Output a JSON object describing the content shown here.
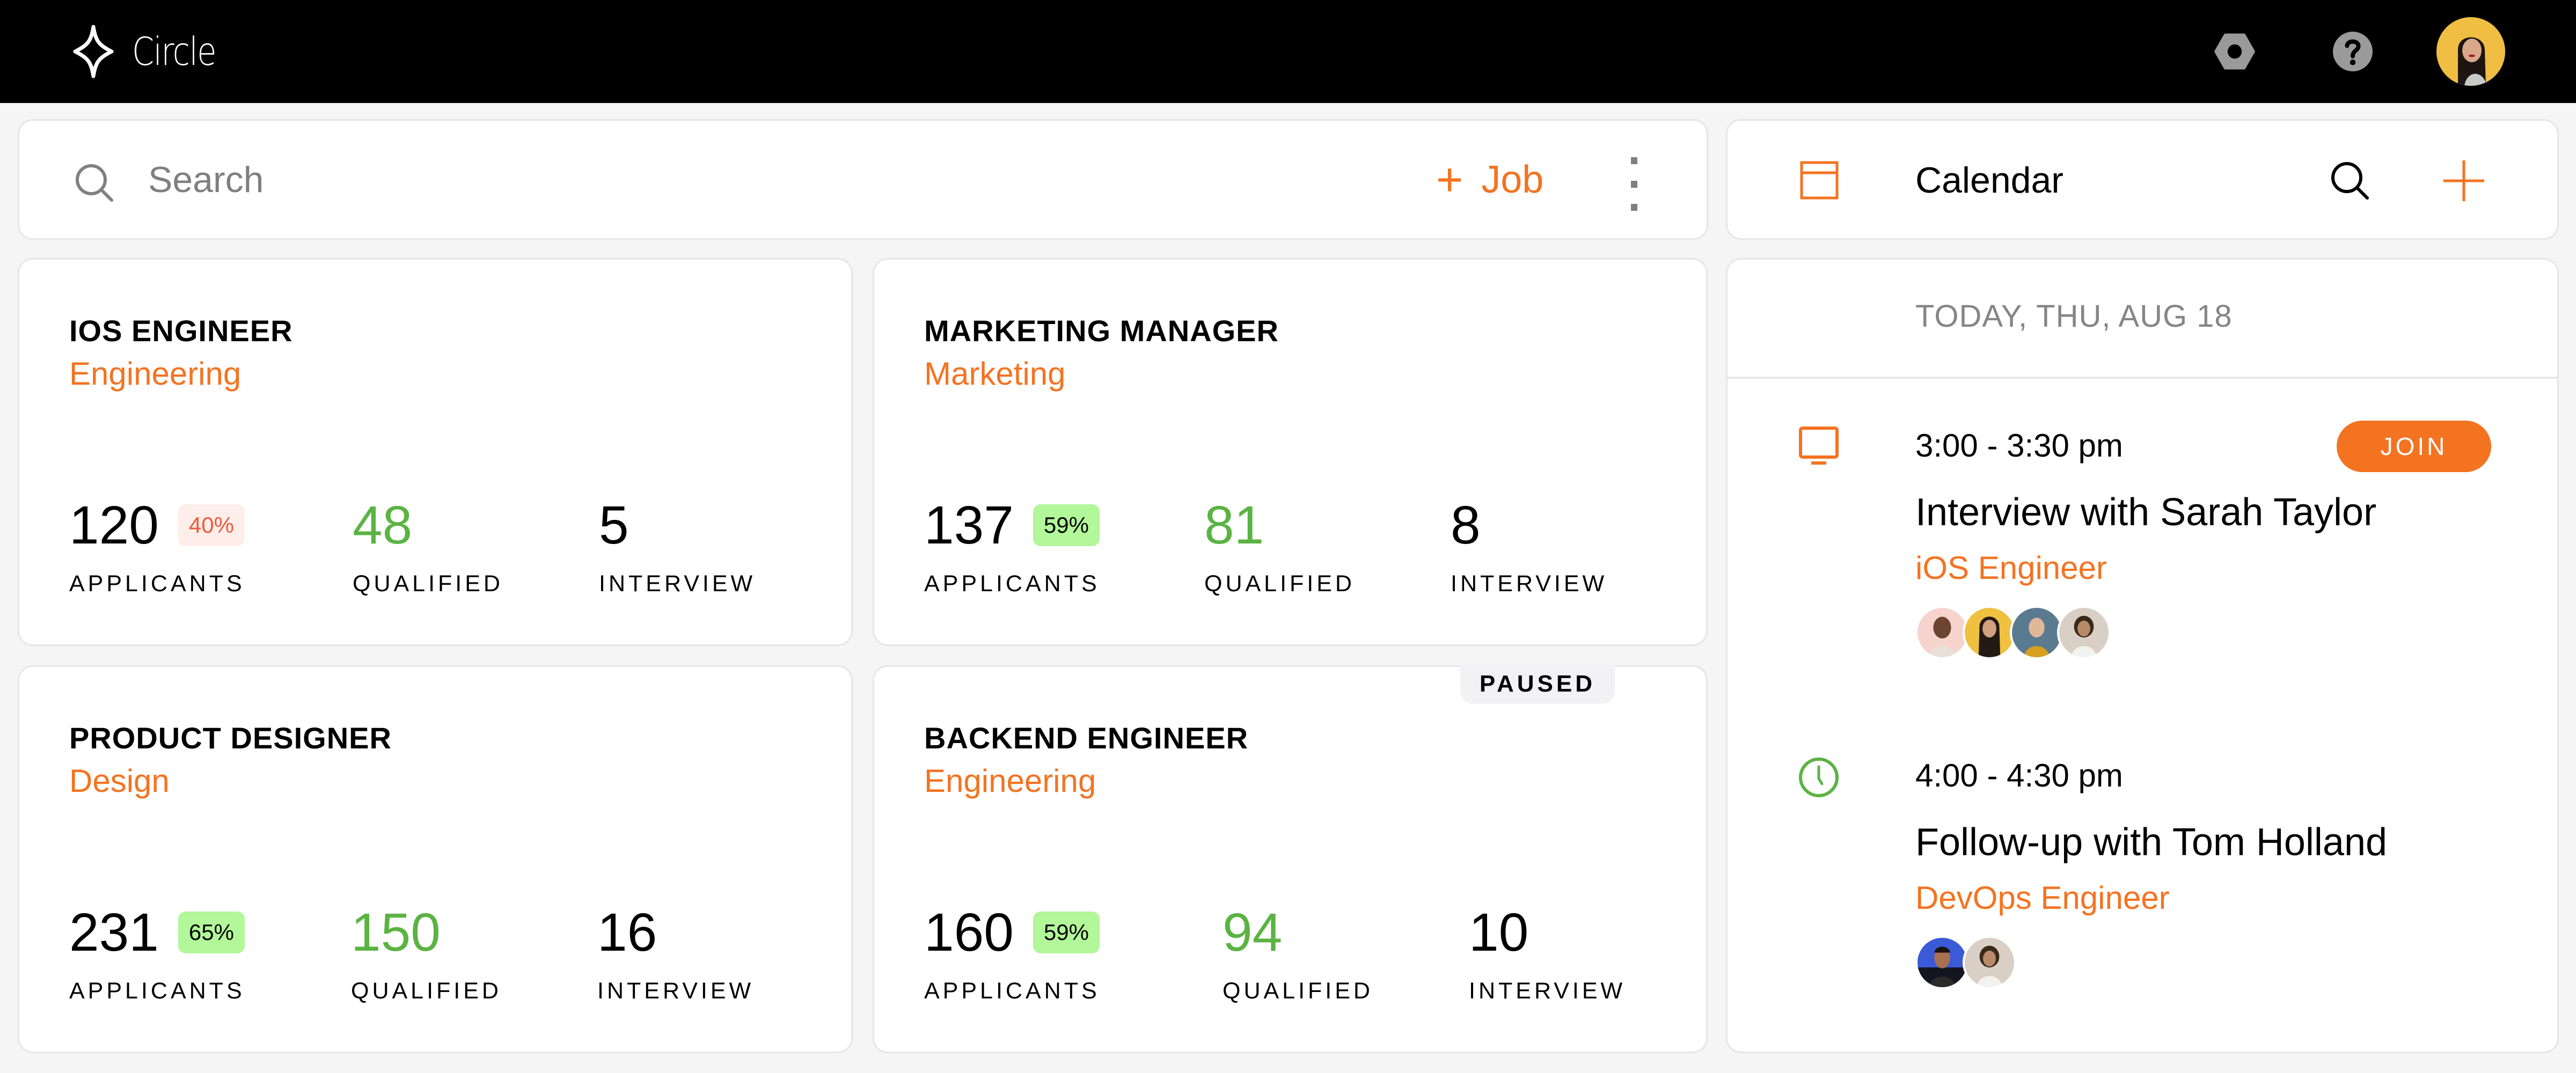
{
  "app": {
    "name": "Circle",
    "icons": {
      "logo": "sparkle-diamond-icon",
      "settings": "hex-nut-settings-icon",
      "help": "question-circle-icon",
      "avatar": "user-avatar"
    }
  },
  "search": {
    "placeholder": "Search",
    "value": "",
    "add_job_plus": "+",
    "add_job_label": "Job"
  },
  "jobs": [
    {
      "title": "IOS ENGINEER",
      "department": "Engineering",
      "applicants": "120",
      "rate": "40%",
      "rate_tone": "red",
      "qualified": "48",
      "interview": "5",
      "status": ""
    },
    {
      "title": "MARKETING MANAGER",
      "department": "Marketing",
      "applicants": "137",
      "rate": "59%",
      "rate_tone": "green",
      "qualified": "81",
      "interview": "8",
      "status": ""
    },
    {
      "title": "PRODUCT DESIGNER",
      "department": "Design",
      "applicants": "231",
      "rate": "65%",
      "rate_tone": "green",
      "qualified": "150",
      "interview": "16",
      "status": ""
    },
    {
      "title": "BACKEND ENGINEER",
      "department": "Engineering",
      "applicants": "160",
      "rate": "59%",
      "rate_tone": "green",
      "qualified": "94",
      "interview": "10",
      "status": "PAUSED"
    }
  ],
  "labels": {
    "applicants": "APPLICANTS",
    "qualified": "QUALIFIED",
    "interview": "INTERVIEW"
  },
  "calendar": {
    "title": "Calendar",
    "date_heading": "TODAY, THU, AUG 18",
    "events": [
      {
        "time": "3:00 - 3:30 pm",
        "title": "Interview with Sarah Taylor",
        "role": "iOS Engineer",
        "icon": "monitor-icon",
        "action": "JOIN",
        "attendees": 4
      },
      {
        "time": "4:00 - 4:30 pm",
        "title": "Follow-up with Tom Holland",
        "role": "DevOps Engineer",
        "icon": "clock-icon",
        "attendees": 2
      }
    ]
  },
  "colors": {
    "accent": "#F47321",
    "positive": "#5BB343",
    "negative": "#F05A3C",
    "badge_green_bg": "#B2F79A",
    "badge_red_bg": "#FDEEEA"
  }
}
